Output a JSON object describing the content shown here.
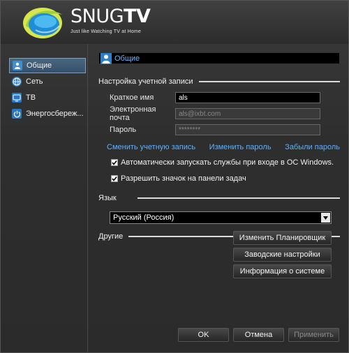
{
  "app": {
    "brand_snug": "SNUG",
    "brand_tv": "TV",
    "tagline": "Just like Watching TV at Home"
  },
  "sidebar": {
    "items": [
      {
        "label": "Общие",
        "icon": "user-icon",
        "active": true
      },
      {
        "label": "Сеть",
        "icon": "globe-icon",
        "active": false
      },
      {
        "label": "ТВ",
        "icon": "tv-icon",
        "active": false
      },
      {
        "label": "Энергосбереж...",
        "icon": "power-icon",
        "active": false
      }
    ]
  },
  "panel": {
    "title": "Общие"
  },
  "account": {
    "section_label": "Настройка учетной записи",
    "short_name_label": "Краткое имя",
    "short_name_value": "als",
    "email_label": "Электронная почта",
    "email_value": "als@ixbt.com",
    "password_label": "Пароль",
    "password_value": "********",
    "link_change_account": "Сменить учетную запись",
    "link_change_password": "Изменить пароль",
    "link_forgot_password": "Забыли пароль",
    "check_autostart": "Автоматически запускать службы при входе в ОС Windows.",
    "check_tray_icon": "Разрешить значок на панели задач"
  },
  "language": {
    "section_label": "Язык",
    "selected": "Русский (Россия)"
  },
  "other": {
    "section_label": "Другие",
    "btn_scheduler": "Изменить Планировщик",
    "btn_factory": "Заводские настройки",
    "btn_sysinfo": "Информация о системе"
  },
  "footer": {
    "ok": "OK",
    "cancel": "Отмена",
    "apply": "Применить"
  },
  "colors": {
    "accent_link": "#5fb0ff",
    "selected_item": "#4b6680",
    "logo_blue": "#2aa0e8",
    "logo_green": "#b6d43a"
  }
}
